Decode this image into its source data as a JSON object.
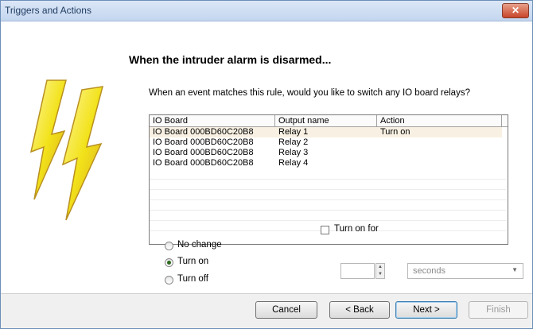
{
  "window": {
    "title": "Triggers and Actions",
    "close_glyph": "✕"
  },
  "header": {
    "title": "When the intruder alarm is disarmed..."
  },
  "question": "When an event matches this rule, would you like to switch any IO board relays?",
  "table": {
    "columns": [
      "IO Board",
      "Output name",
      "Action"
    ],
    "rows": [
      {
        "io_board": "IO Board 000BD60C20B8",
        "output": "Relay 1",
        "action": "Turn on"
      },
      {
        "io_board": "IO Board 000BD60C20B8",
        "output": "Relay 2",
        "action": ""
      },
      {
        "io_board": "IO Board 000BD60C20B8",
        "output": "Relay 3",
        "action": ""
      },
      {
        "io_board": "IO Board 000BD60C20B8",
        "output": "Relay 4",
        "action": ""
      }
    ],
    "selected_row": 0
  },
  "options": {
    "no_change": "No change",
    "turn_on": "Turn on",
    "turn_off": "Turn off",
    "selected": "turn_on"
  },
  "turn_on_for": {
    "label": "Turn on for",
    "checked": false,
    "value": "",
    "unit": "seconds",
    "spin_up": "▲",
    "spin_down": "▼",
    "dropdown_glyph": "▼"
  },
  "footer": {
    "cancel": "Cancel",
    "back": "< Back",
    "next": "Next >",
    "finish": "Finish"
  },
  "colors": {
    "bolt_fill": "#f2e21a",
    "bolt_shade": "#d8a81e",
    "accent": "#3c7fb1"
  },
  "icons": {
    "decoration": "lightning-bolts-icon"
  }
}
